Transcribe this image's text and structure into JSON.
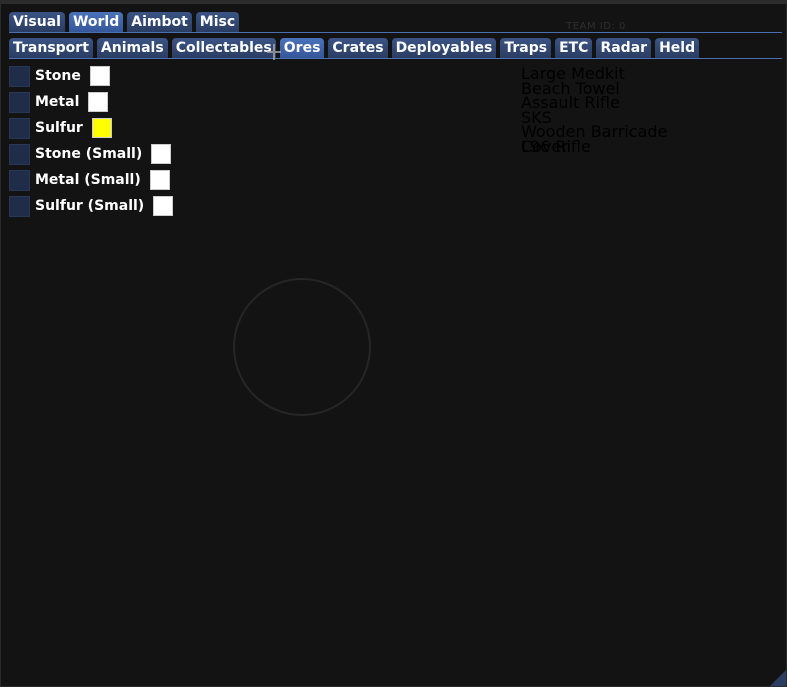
{
  "main_tabs": [
    {
      "label": "Visual",
      "active": false
    },
    {
      "label": "World",
      "active": true
    },
    {
      "label": "Aimbot",
      "active": false
    },
    {
      "label": "Misc",
      "active": false
    }
  ],
  "sub_tabs": [
    {
      "label": "Transport",
      "active": false
    },
    {
      "label": "Animals",
      "active": false
    },
    {
      "label": "Collectables",
      "active": false
    },
    {
      "label": "Ores",
      "active": true
    },
    {
      "label": "Crates",
      "active": false
    },
    {
      "label": "Deployables",
      "active": false
    },
    {
      "label": "Traps",
      "active": false
    },
    {
      "label": "ETC",
      "active": false
    },
    {
      "label": "Radar",
      "active": false
    },
    {
      "label": "Held",
      "active": false
    }
  ],
  "ores": [
    {
      "label": "Stone",
      "color": "#ffffff"
    },
    {
      "label": "Metal",
      "color": "#ffffff"
    },
    {
      "label": "Sulfur",
      "color": "#ffff00"
    },
    {
      "label": "Stone (Small)",
      "color": "#ffffff"
    },
    {
      "label": "Metal (Small)",
      "color": "#ffffff"
    },
    {
      "label": "Sulfur (Small)",
      "color": "#ffffff"
    }
  ],
  "background": {
    "team_id": "TEAM ID: 0",
    "items": [
      "Large Medkit",
      "Beach Towel",
      "Assault Rifle",
      "SKS",
      "Wooden Barricade Cover",
      "L96 Rifle"
    ]
  },
  "colors": {
    "tab": "#2a3d63",
    "tab_active": "#35569a",
    "separator": "#4a6fb0",
    "toggle": "#1f2d48"
  }
}
